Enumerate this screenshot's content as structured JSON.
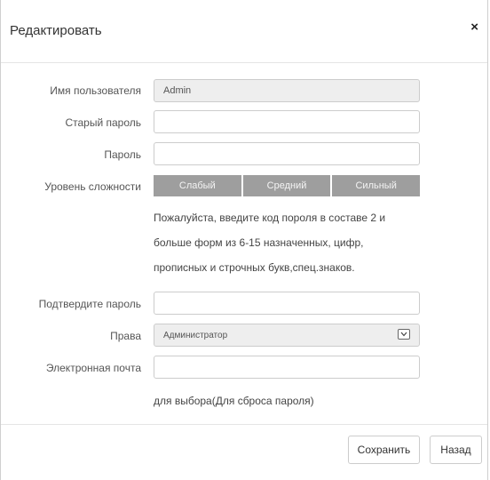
{
  "dialog": {
    "title": "Редактировать",
    "close_label": "×"
  },
  "form": {
    "username": {
      "label": "Имя пользователя",
      "value": "Admin"
    },
    "old_password": {
      "label": "Старый пароль",
      "value": ""
    },
    "password": {
      "label": "Пароль",
      "value": ""
    },
    "strength": {
      "label": "Уровень сложности",
      "levels": [
        "Слабый",
        "Средний",
        "Сильный"
      ]
    },
    "password_hint": [
      "Пожалуйста, введите код пороля в составе 2 и",
      "больше форм из 6-15 назначенных, цифр,",
      "прописных и строчных букв,спец.знаков."
    ],
    "confirm_password": {
      "label": "Подтвердите пароль",
      "value": ""
    },
    "rights": {
      "label": "Права",
      "value": "Администратор"
    },
    "email": {
      "label": "Электронная почта",
      "value": "",
      "hint": "для выбора(Для сброса пароля)"
    }
  },
  "footer": {
    "save_label": "Сохранить",
    "back_label": "Назад"
  }
}
